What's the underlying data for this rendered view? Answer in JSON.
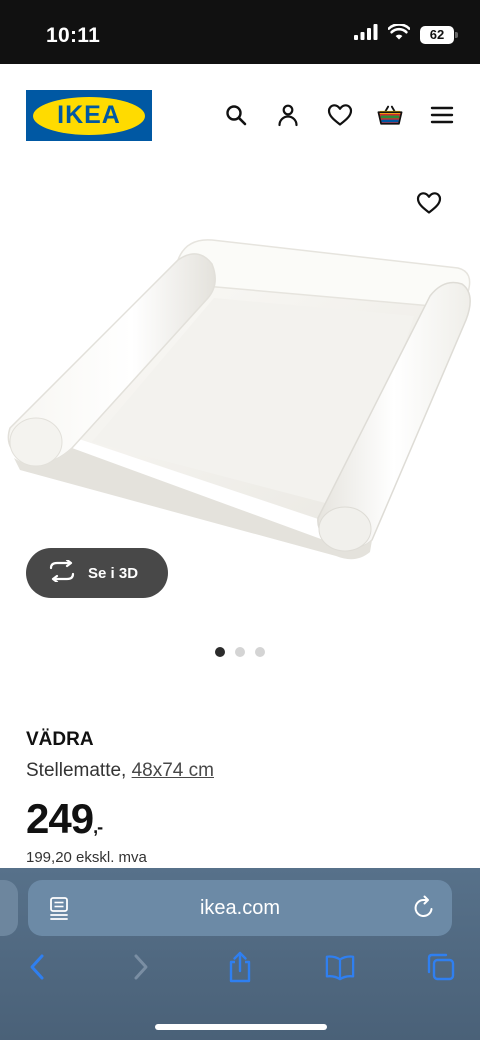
{
  "status_bar": {
    "time": "10:11",
    "battery": "62"
  },
  "header": {
    "logo_text": "IKEA",
    "icons": [
      "search-icon",
      "account-icon",
      "heart-icon",
      "basket-icon",
      "menu-icon"
    ]
  },
  "gallery": {
    "view_3d_label": "Se i 3D",
    "slide_count": 3,
    "active_slide": 1
  },
  "product": {
    "name": "VÄDRA",
    "type": "Stellematte,",
    "size": "48x74 cm",
    "price": "249",
    "price_suffix": ",-",
    "price_ex_vat": "199,20 ekskl. mva"
  },
  "browser": {
    "url": "ikea.com",
    "toolbar_icons": [
      "back-icon",
      "forward-icon",
      "share-icon",
      "bookmarks-icon",
      "tabs-icon"
    ]
  },
  "colors": {
    "brand_blue": "#0058a3",
    "brand_yellow": "#ffdb00",
    "browser_bar": "#57718a",
    "safari_blue": "#2f7ff0"
  }
}
